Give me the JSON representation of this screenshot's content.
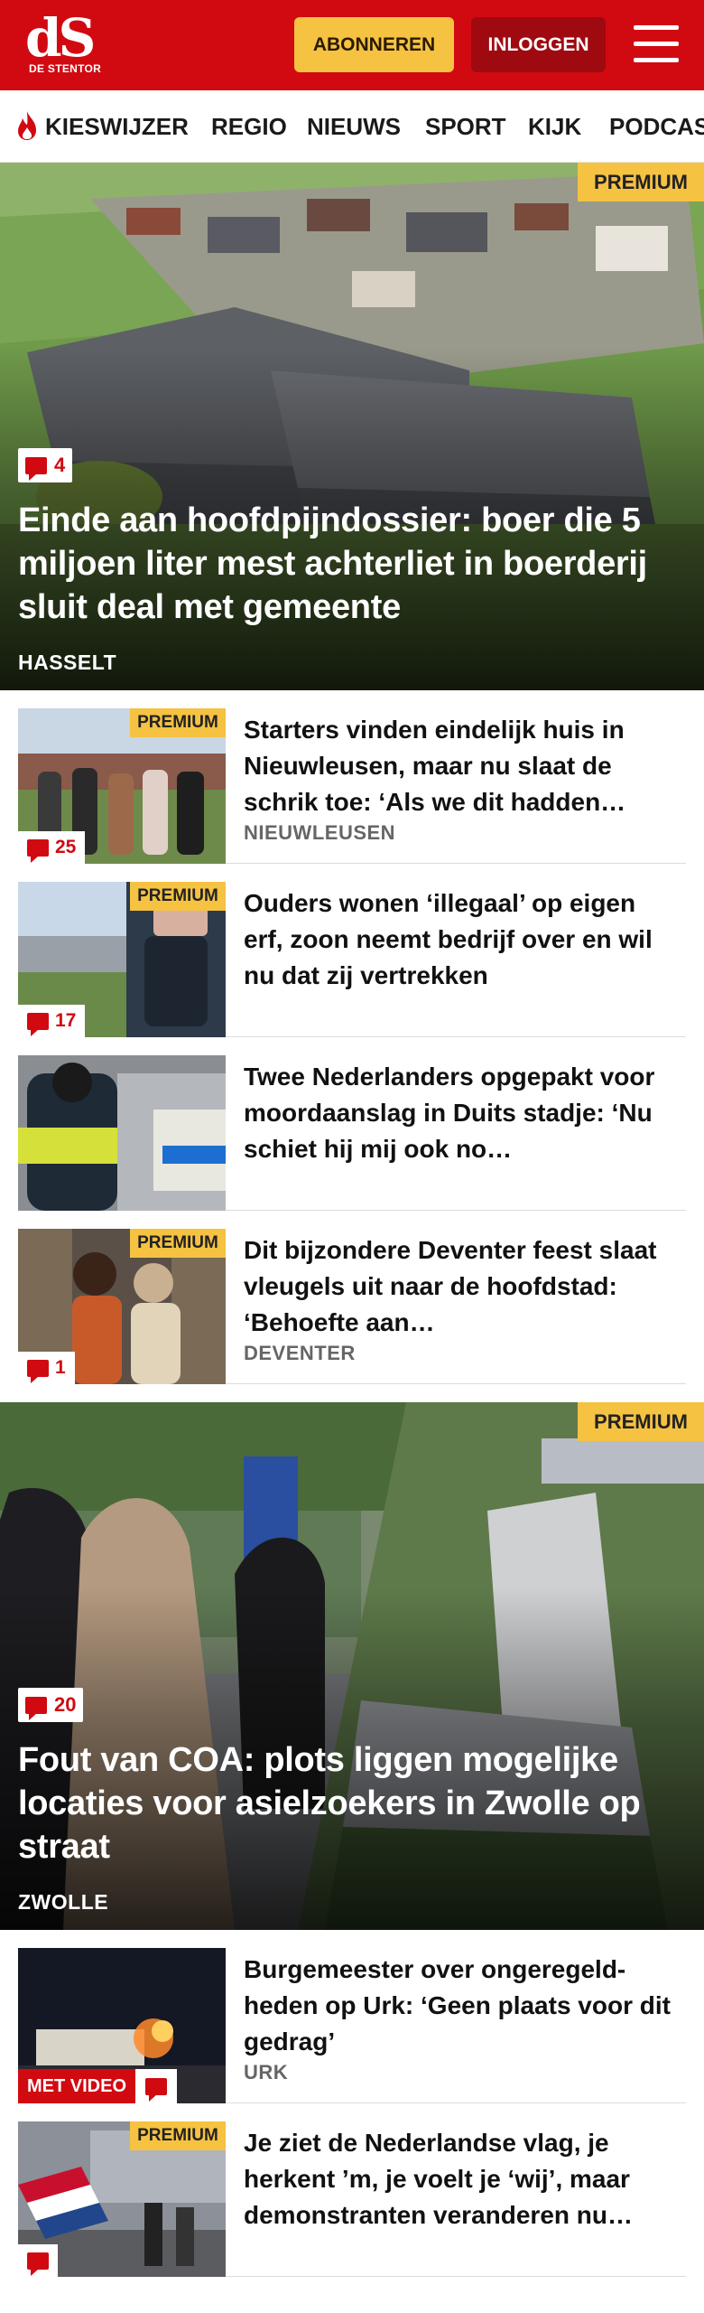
{
  "brand": {
    "logo_mark": "dS",
    "logo_sub": "DE STENTOR",
    "red": "#d10a11",
    "yellow": "#f5c242"
  },
  "header": {
    "subscribe_label": "ABONNEREN",
    "login_label": "INLOGGEN",
    "menu_icon": "hamburger-icon"
  },
  "nav": {
    "items": [
      {
        "label": "KIESWIJZER",
        "icon": "flame-icon"
      },
      {
        "label": "REGIO"
      },
      {
        "label": "NIEUWS"
      },
      {
        "label": "SPORT"
      },
      {
        "label": "KIJK"
      },
      {
        "label": "PODCAST"
      }
    ]
  },
  "premium_label": "PREMIUM",
  "hero1": {
    "comments": "4",
    "title": "Einde aan hoofdpijndossier: boer die 5 miljoen liter mest achterliet in boerderij sluit deal met gemeente",
    "location": "HASSELT"
  },
  "articles": [
    {
      "title": "Starters vinden eindelijk huis in Nieuwleusen, maar nu slaat de schrik toe: ‘Als we dit hadden…",
      "location": "NIEUWLEUSEN",
      "comments": "25"
    },
    {
      "title": "Ouders wonen ‘illegaal’ op eigen erf, zoon neemt bedrijf over en wil nu dat zij vertrekken",
      "location": "",
      "comments": "17"
    },
    {
      "title": "Twee Nederlanders opgepakt voor moordaanslag in Duits stadje: ‘Nu schiet hij mij ook no…",
      "location": "",
      "comments": ""
    },
    {
      "title": "Dit bijzondere Deventer feest slaat vleugels uit naar de hoofdstad: ‘Behoefte aan…",
      "location": "DEVENTER",
      "comments": "1"
    }
  ],
  "hero2": {
    "comments": "20",
    "title": "Fout van COA: plots liggen mogelijke locaties voor asielzoekers in Zwolle op straat",
    "location": "ZWOLLE"
  },
  "articles2": [
    {
      "title": "Burgemeester over ongeregeld-heden op Urk: ‘Geen plaats voor dit gedrag’",
      "location": "URK",
      "video_label": "MET VIDEO"
    },
    {
      "title": "Je ziet de Nederlandse vlag, je herkent ’m, je voelt je ‘wij’, maar demonstranten veranderen nu…",
      "location": ""
    }
  ]
}
